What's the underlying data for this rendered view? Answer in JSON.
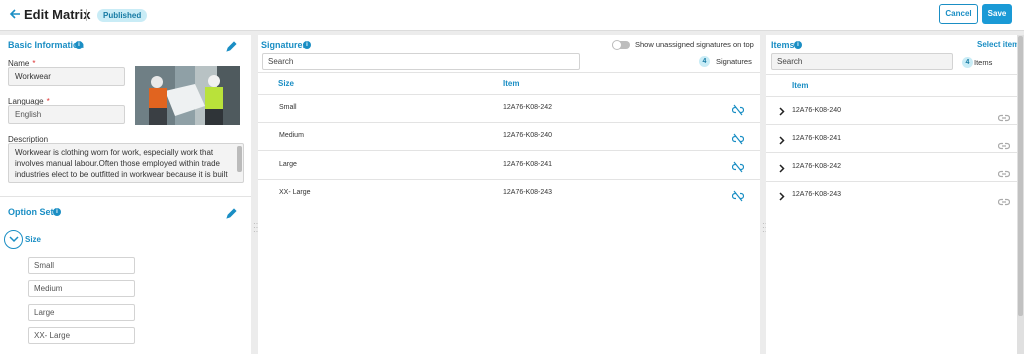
{
  "header": {
    "title": "Edit Matrix",
    "status": "Published",
    "cancel_label": "Cancel",
    "save_label": "Save"
  },
  "basic_info": {
    "title": "Basic Information",
    "name_label": "Name",
    "name_value": "Workwear",
    "language_label": "Language",
    "language_value": "English",
    "description_label": "Description",
    "description_value": "Workwear is clothing worn for work, especially work that involves manual labour.Often those employed within trade industries elect to be outfitted in workwear because it is built to provide durability and safety."
  },
  "option_sets": {
    "title": "Option Sets",
    "set_name": "Size",
    "options": [
      "Small",
      "Medium",
      "Large",
      "XX- Large"
    ]
  },
  "signatures": {
    "title": "Signatures",
    "toggle_label": "Show unassigned signatures on top",
    "search_placeholder": "Search",
    "count": "4",
    "count_label": "Signatures",
    "col_size": "Size",
    "col_item": "Item",
    "rows": [
      {
        "size": "Small",
        "item": "12A76-K08-242"
      },
      {
        "size": "Medium",
        "item": "12A76-K08-240"
      },
      {
        "size": "Large",
        "item": "12A76-K08-241"
      },
      {
        "size": "XX- Large",
        "item": "12A76-K08-243"
      }
    ]
  },
  "items": {
    "title": "Items",
    "select_label": "Select item",
    "search_placeholder": "Search",
    "count": "4",
    "count_label": "Items",
    "col_item": "Item",
    "rows": [
      "12A76-K08-240",
      "12A76-K08-241",
      "12A76-K08-242",
      "12A76-K08-243"
    ]
  },
  "icons": [
    "back-arrow-icon",
    "info-icon",
    "pencil-icon",
    "chevron-down-icon",
    "chevron-right-icon",
    "unlink-icon",
    "link-icon"
  ],
  "colors": {
    "accent": "#1a8ec4",
    "badge_bg": "#c9ecf6",
    "save_bg": "#1a9ad6"
  }
}
